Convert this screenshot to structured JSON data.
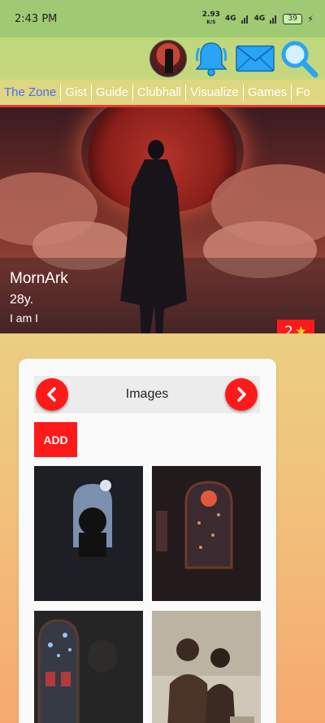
{
  "status": {
    "time": "2:43 PM",
    "speed": "2.93",
    "speed_unit": "K/S",
    "net1": "4G",
    "net2": "4G",
    "battery": "39"
  },
  "header": {
    "icons": [
      "avatar",
      "bell-icon",
      "mail-icon",
      "search-icon"
    ]
  },
  "tabs": [
    {
      "label": "The Zone",
      "active": true
    },
    {
      "label": "Gist"
    },
    {
      "label": "Guide"
    },
    {
      "label": "Clubhall"
    },
    {
      "label": "Visualize"
    },
    {
      "label": "Games"
    },
    {
      "label": "Fo"
    }
  ],
  "profile": {
    "name": "MornArk",
    "age": "28y.",
    "bio": "I am I",
    "stars": "2",
    "star_glyph": "★"
  },
  "gallery": {
    "title": "Images",
    "add_label": "ADD"
  },
  "colors": {
    "accent_red": "#ff1a1a",
    "tab_active": "#4a6cff",
    "icon_blue": "#2aa4f4"
  }
}
